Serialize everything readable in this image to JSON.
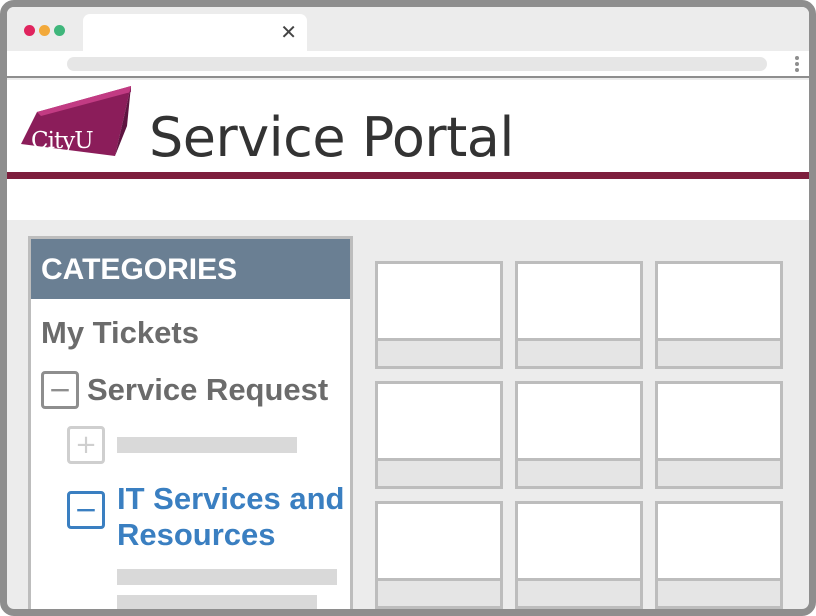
{
  "header": {
    "logo_text": "CityU",
    "title": "Service Portal"
  },
  "sidebar": {
    "heading": "CATEGORIES",
    "my_tickets": "My Tickets",
    "service_request": {
      "toggle": "−",
      "label": "Service Request",
      "expanded": true
    },
    "collapsed_child": {
      "toggle": "+"
    },
    "it_services": {
      "toggle": "−",
      "label": "IT Services and Resources",
      "expanded": true
    }
  },
  "colors": {
    "brand_maroon": "#7d1e3d",
    "category_header": "#6a7f93",
    "link_blue": "#3a7fc1",
    "text_gray": "#6b6b6b"
  },
  "grid": {
    "rows": 3,
    "cols": 3
  }
}
